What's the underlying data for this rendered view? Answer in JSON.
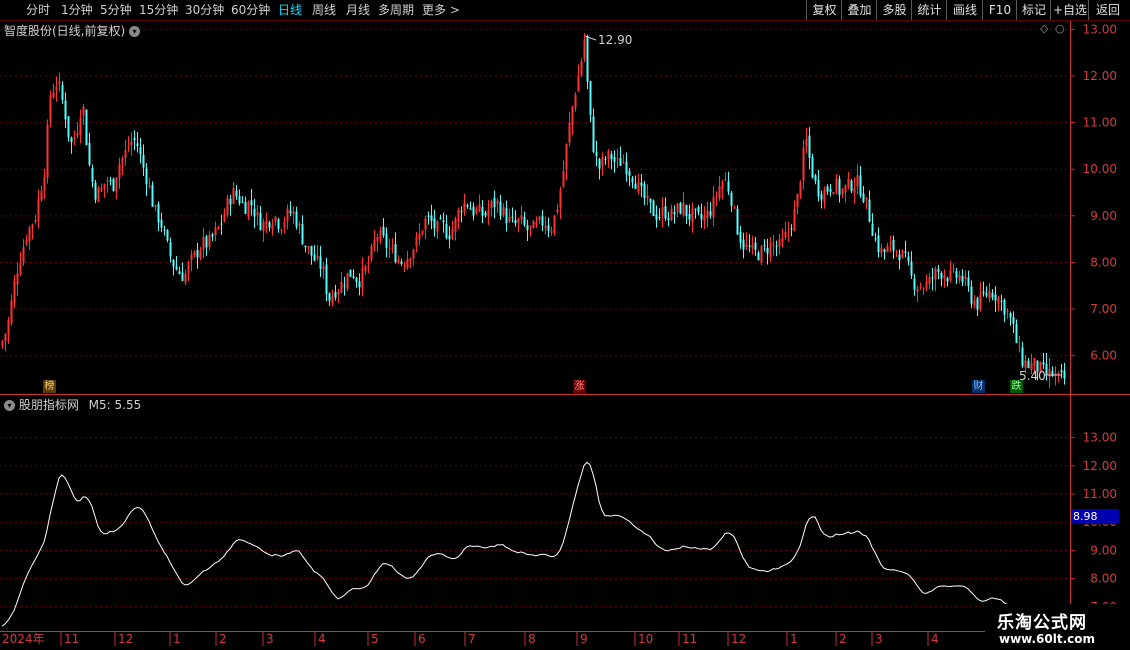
{
  "toolbar": {
    "periods": [
      "分时",
      "1分钟",
      "5分钟",
      "15分钟",
      "30分钟",
      "60分钟",
      "日线",
      "周线",
      "月线",
      "多周期",
      "更多"
    ],
    "selected_period": "日线",
    "right_buttons": [
      "复权",
      "叠加",
      "多股",
      "统计",
      "画线",
      "F10",
      "标记",
      "+自选",
      "返回"
    ]
  },
  "main_chart": {
    "title": "智度股份(日线,前复权)",
    "price_ticks": [
      "13.00",
      "12.00",
      "11.00",
      "10.00",
      "9.00",
      "8.00",
      "7.00",
      "6.00"
    ],
    "high_label": "12.90",
    "low_label": "5.40"
  },
  "badges": [
    "榜",
    "涨",
    "财",
    "跌"
  ],
  "indicator": {
    "title": "股朋指标网",
    "m5_label": "M5:",
    "m5_value": "5.55",
    "ticks": [
      "13.00",
      "12.00",
      "11.00",
      "10.00",
      "9.00",
      "8.00",
      "7.00"
    ],
    "cursor_value": "8.98"
  },
  "time_axis": [
    "2024年",
    "11",
    "12",
    "1",
    "2",
    "3",
    "4",
    "5",
    "6",
    "7",
    "8",
    "9",
    "10",
    "11",
    "12",
    "1",
    "2",
    "3",
    "4"
  ],
  "watermark": {
    "name": "乐淘公式网",
    "url": "www.60lt.com"
  },
  "colors": {
    "up": "#ff3232",
    "down": "#54fcfc",
    "grid": "#700000",
    "axis": "#c83232",
    "line": "#ffffff",
    "cursor_bg": "#0000b0"
  },
  "chart_data": {
    "type": "candlestick",
    "anchors": [
      [
        0,
        6.2
      ],
      [
        7,
        6.6
      ],
      [
        16,
        7.8
      ],
      [
        26,
        8.6
      ],
      [
        35,
        9.0
      ],
      [
        44,
        10.0
      ],
      [
        50,
        11.6
      ],
      [
        57,
        11.9
      ],
      [
        64,
        11.3
      ],
      [
        70,
        10.5
      ],
      [
        76,
        10.8
      ],
      [
        82,
        11.5
      ],
      [
        88,
        10.2
      ],
      [
        94,
        9.5
      ],
      [
        100,
        9.5
      ],
      [
        106,
        9.8
      ],
      [
        112,
        9.6
      ],
      [
        118,
        10.1
      ],
      [
        124,
        10.3
      ],
      [
        130,
        10.6
      ],
      [
        136,
        10.6
      ],
      [
        142,
        10.1
      ],
      [
        148,
        9.7
      ],
      [
        154,
        9.1
      ],
      [
        160,
        8.9
      ],
      [
        166,
        8.4
      ],
      [
        172,
        8.0
      ],
      [
        178,
        7.8
      ],
      [
        184,
        7.7
      ],
      [
        190,
        8.0
      ],
      [
        196,
        8.2
      ],
      [
        202,
        8.4
      ],
      [
        208,
        8.4
      ],
      [
        214,
        8.6
      ],
      [
        220,
        8.8
      ],
      [
        226,
        9.2
      ],
      [
        232,
        9.5
      ],
      [
        238,
        9.4
      ],
      [
        244,
        9.2
      ],
      [
        250,
        9.3
      ],
      [
        256,
        9.0
      ],
      [
        262,
        8.8
      ],
      [
        268,
        8.9
      ],
      [
        274,
        9.0
      ],
      [
        280,
        8.8
      ],
      [
        286,
        9.0
      ],
      [
        292,
        9.1
      ],
      [
        298,
        8.8
      ],
      [
        304,
        8.4
      ],
      [
        310,
        8.2
      ],
      [
        316,
        8.0
      ],
      [
        322,
        7.9
      ],
      [
        328,
        7.2
      ],
      [
        334,
        7.4
      ],
      [
        340,
        7.5
      ],
      [
        346,
        7.7
      ],
      [
        352,
        7.8
      ],
      [
        358,
        7.6
      ],
      [
        364,
        7.8
      ],
      [
        370,
        8.1
      ],
      [
        376,
        8.6
      ],
      [
        382,
        8.5
      ],
      [
        388,
        8.3
      ],
      [
        394,
        8.2
      ],
      [
        400,
        8.0
      ],
      [
        406,
        8.1
      ],
      [
        412,
        8.3
      ],
      [
        418,
        8.5
      ],
      [
        424,
        8.9
      ],
      [
        430,
        8.9
      ],
      [
        436,
        8.7
      ],
      [
        442,
        8.8
      ],
      [
        448,
        8.6
      ],
      [
        454,
        8.8
      ],
      [
        460,
        9.2
      ],
      [
        466,
        9.3
      ],
      [
        472,
        9.1
      ],
      [
        478,
        9.1
      ],
      [
        484,
        9.0
      ],
      [
        490,
        9.2
      ],
      [
        496,
        9.3
      ],
      [
        502,
        9.1
      ],
      [
        508,
        8.9
      ],
      [
        514,
        8.8
      ],
      [
        520,
        8.9
      ],
      [
        526,
        8.7
      ],
      [
        532,
        8.7
      ],
      [
        538,
        8.8
      ],
      [
        544,
        8.9
      ],
      [
        550,
        8.7
      ],
      [
        556,
        9.1
      ],
      [
        562,
        9.8
      ],
      [
        568,
        10.8
      ],
      [
        574,
        11.6
      ],
      [
        580,
        12.2
      ],
      [
        584,
        12.8
      ],
      [
        588,
        11.5
      ],
      [
        592,
        10.6
      ],
      [
        598,
        10.0
      ],
      [
        604,
        10.2
      ],
      [
        610,
        10.3
      ],
      [
        616,
        10.1
      ],
      [
        622,
        10.2
      ],
      [
        628,
        10.0
      ],
      [
        634,
        9.8
      ],
      [
        640,
        9.5
      ],
      [
        646,
        9.3
      ],
      [
        652,
        9.1
      ],
      [
        658,
        9.0
      ],
      [
        664,
        9.1
      ],
      [
        670,
        9.0
      ],
      [
        676,
        9.1
      ],
      [
        682,
        9.2
      ],
      [
        688,
        9.0
      ],
      [
        694,
        9.0
      ],
      [
        700,
        8.9
      ],
      [
        706,
        9.0
      ],
      [
        712,
        9.2
      ],
      [
        718,
        9.6
      ],
      [
        724,
        9.8
      ],
      [
        730,
        9.5
      ],
      [
        736,
        8.8
      ],
      [
        742,
        8.4
      ],
      [
        748,
        8.3
      ],
      [
        754,
        8.2
      ],
      [
        760,
        8.2
      ],
      [
        766,
        8.3
      ],
      [
        772,
        8.4
      ],
      [
        778,
        8.3
      ],
      [
        784,
        8.5
      ],
      [
        790,
        8.8
      ],
      [
        796,
        9.2
      ],
      [
        802,
        10.2
      ],
      [
        806,
        10.6
      ],
      [
        810,
        10.1
      ],
      [
        816,
        9.6
      ],
      [
        822,
        9.5
      ],
      [
        828,
        9.6
      ],
      [
        834,
        9.7
      ],
      [
        840,
        9.5
      ],
      [
        846,
        9.6
      ],
      [
        852,
        9.7
      ],
      [
        858,
        9.7
      ],
      [
        864,
        9.4
      ],
      [
        870,
        8.9
      ],
      [
        876,
        8.4
      ],
      [
        882,
        8.2
      ],
      [
        888,
        8.3
      ],
      [
        894,
        8.3
      ],
      [
        900,
        8.2
      ],
      [
        906,
        8.0
      ],
      [
        912,
        7.6
      ],
      [
        918,
        7.5
      ],
      [
        924,
        7.5
      ],
      [
        930,
        7.6
      ],
      [
        936,
        7.8
      ],
      [
        942,
        7.8
      ],
      [
        948,
        7.7
      ],
      [
        954,
        7.7
      ],
      [
        960,
        7.7
      ],
      [
        966,
        7.5
      ],
      [
        972,
        7.2
      ],
      [
        978,
        7.1
      ],
      [
        984,
        7.3
      ],
      [
        990,
        7.4
      ],
      [
        996,
        7.3
      ],
      [
        1002,
        7.1
      ],
      [
        1008,
        6.9
      ],
      [
        1014,
        6.5
      ],
      [
        1018,
        6.1
      ],
      [
        1022,
        5.9
      ],
      [
        1028,
        5.8
      ],
      [
        1034,
        5.8
      ],
      [
        1040,
        5.7
      ],
      [
        1046,
        5.6
      ],
      [
        1052,
        5.6
      ],
      [
        1058,
        5.5
      ],
      [
        1064,
        5.5
      ]
    ],
    "series": [
      {
        "name": "M5",
        "values": "moving average of closes"
      }
    ],
    "high": 12.9,
    "low": 5.4,
    "price_range": [
      5.2,
      13.2
    ]
  }
}
